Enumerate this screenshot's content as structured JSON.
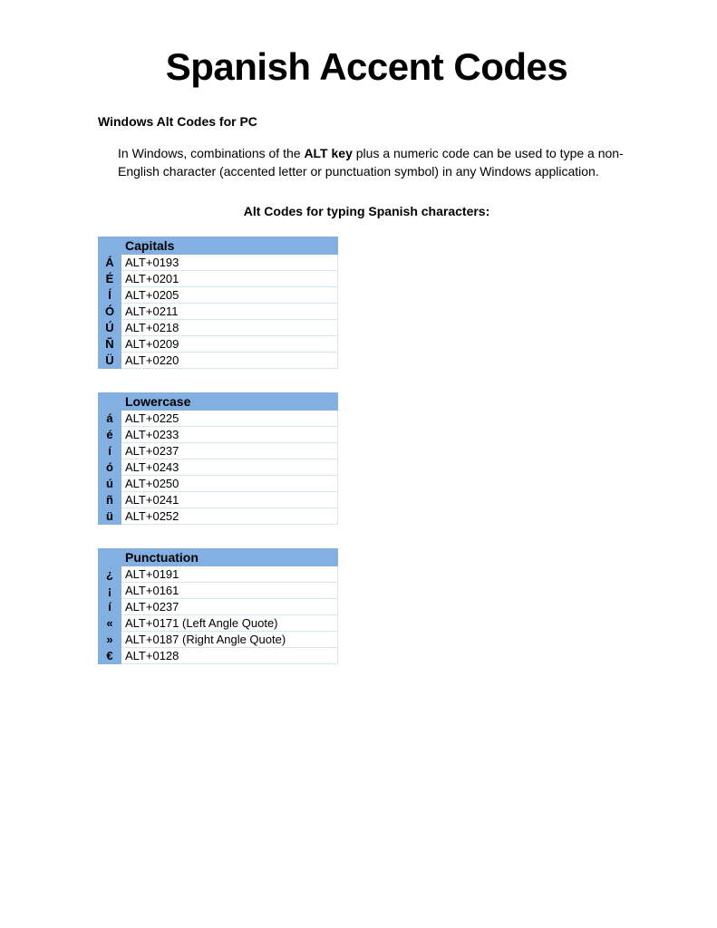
{
  "title": "Spanish Accent Codes",
  "subtitle": "Windows Alt Codes for PC",
  "description": {
    "pre": "In Windows, combinations of the ",
    "bold": "ALT key",
    "post": " plus a numeric code can be used to type a non-English character (accented letter or punctuation symbol) in any Windows application."
  },
  "sectionHeader": "Alt Codes for typing Spanish characters:",
  "tables": [
    {
      "header": "Capitals",
      "rows": [
        {
          "char": "Á",
          "code": "ALT+0193"
        },
        {
          "char": "É",
          "code": "ALT+0201"
        },
        {
          "char": "Í",
          "code": "ALT+0205"
        },
        {
          "char": "Ó",
          "code": "ALT+0211"
        },
        {
          "char": "Ú",
          "code": "ALT+0218"
        },
        {
          "char": "Ñ",
          "code": "ALT+0209"
        },
        {
          "char": "Ü",
          "code": "ALT+0220"
        }
      ]
    },
    {
      "header": "Lowercase",
      "rows": [
        {
          "char": "á",
          "code": "ALT+0225"
        },
        {
          "char": "é",
          "code": "ALT+0233"
        },
        {
          "char": "í",
          "code": "ALT+0237"
        },
        {
          "char": "ó",
          "code": "ALT+0243"
        },
        {
          "char": "ú",
          "code": "ALT+0250"
        },
        {
          "char": "ñ",
          "code": "ALT+0241"
        },
        {
          "char": "ü",
          "code": "ALT+0252"
        }
      ]
    },
    {
      "header": "Punctuation",
      "rows": [
        {
          "char": "¿",
          "code": "ALT+0191"
        },
        {
          "char": "¡",
          "code": "ALT+0161"
        },
        {
          "char": "í",
          "code": "ALT+0237"
        },
        {
          "char": "«",
          "code": "ALT+0171 (Left Angle Quote)"
        },
        {
          "char": "»",
          "code": "ALT+0187 (Right Angle Quote)"
        },
        {
          "char": "€",
          "code": "ALT+0128"
        }
      ]
    }
  ]
}
